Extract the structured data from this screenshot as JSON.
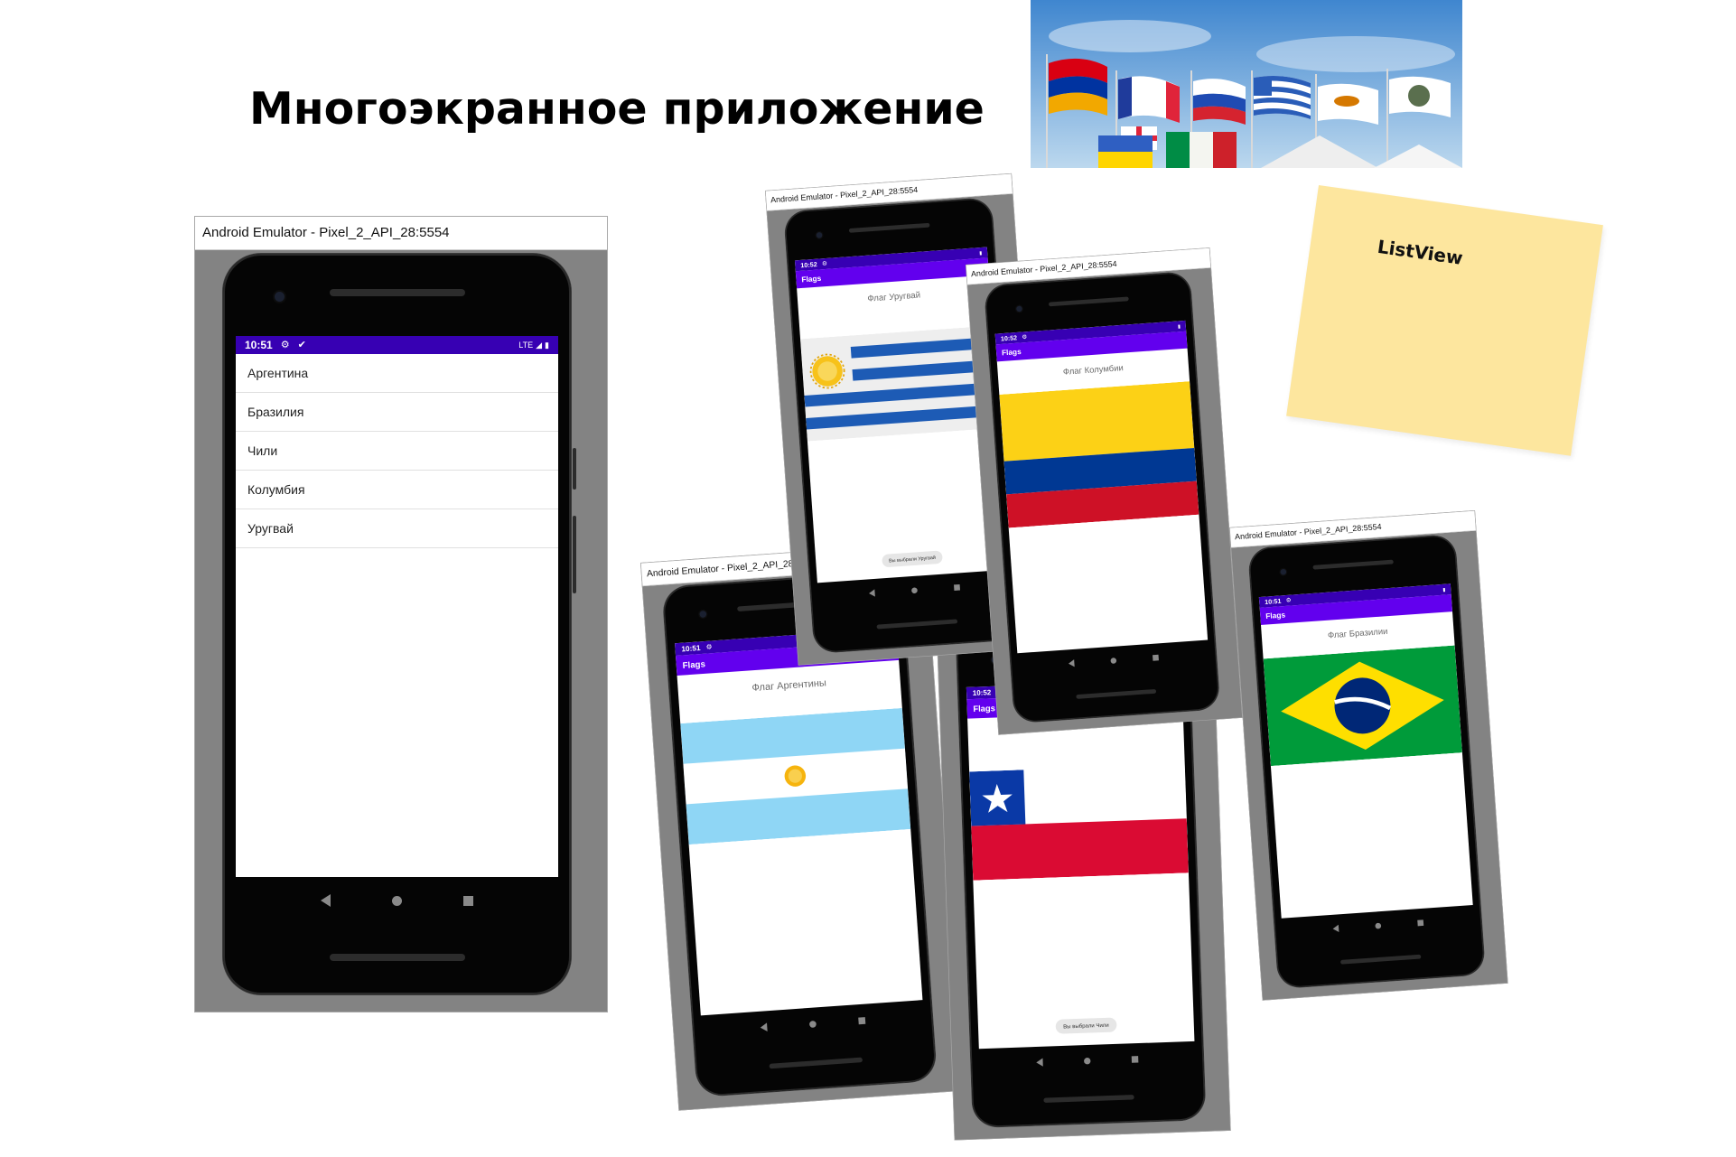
{
  "slide": {
    "title": "Многоэкранное приложение"
  },
  "sticky_note": {
    "label": "ListView"
  },
  "emulator_title": "Android Emulator - Pixel_2_API_28:5554",
  "main_screen": {
    "time": "10:51",
    "signal": "LTE",
    "countries": [
      "Аргентина",
      "Бразилия",
      "Чили",
      "Колумбия",
      "Уругвай"
    ]
  },
  "detail_screens": {
    "app_bar_title": "Flags",
    "uruguay": {
      "time": "10:52",
      "title": "Флаг Уругвай",
      "toast": "Вы выбрали Уругвай"
    },
    "colombia": {
      "time": "10:52",
      "title": "Флаг Колумбии"
    },
    "argentina": {
      "time": "10:51",
      "title": "Флаг Аргентины"
    },
    "chile": {
      "time": "10:52",
      "toast": "Вы выбрали Чили"
    },
    "brazil": {
      "time": "10:51",
      "title": "Флаг Бразилии"
    }
  },
  "colors": {
    "status_bar": "#3700b3",
    "app_bar": "#6200ee",
    "sticky_note": "#fde69e",
    "emulator_frame": "#838383"
  }
}
